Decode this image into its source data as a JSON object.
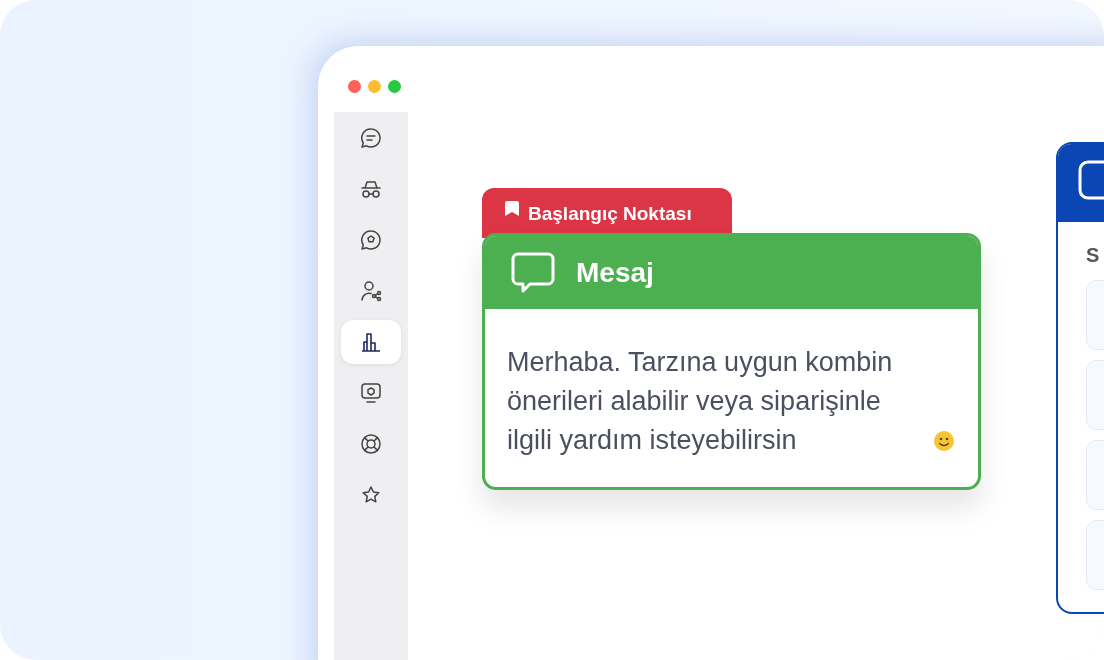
{
  "window": {
    "controls": [
      {
        "color": "#fe5f57"
      },
      {
        "color": "#febc2e"
      },
      {
        "color": "#28c840"
      }
    ]
  },
  "sidebar": {
    "items": [
      {
        "kind": "chat",
        "selected": false
      },
      {
        "kind": "incognito",
        "selected": false
      },
      {
        "kind": "badge-chat",
        "selected": false
      },
      {
        "kind": "user-share",
        "selected": false
      },
      {
        "kind": "chart",
        "selected": true
      },
      {
        "kind": "monitor",
        "selected": false
      },
      {
        "kind": "lifebuoy",
        "selected": false
      },
      {
        "kind": "star",
        "selected": false
      }
    ]
  },
  "start_node": {
    "tag": "Başlangıç Noktası",
    "title": "Mesaj",
    "message": "Merhaba. Tarzına uygun kombin önerileri alabilir veya siparişinle ilgili yardım isteyebilirsin"
  },
  "next_node": {
    "heading": "S"
  }
}
